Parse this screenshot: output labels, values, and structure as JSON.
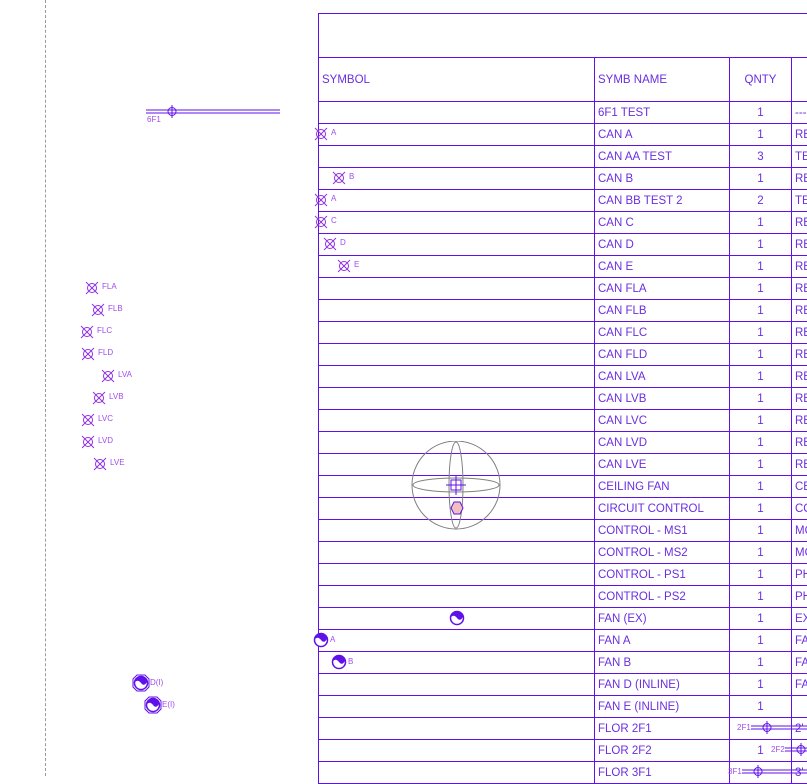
{
  "drawing": {
    "table": {
      "title": "",
      "headers": {
        "symbol": "SYMBOL",
        "symb_name": "SYMB NAME",
        "qnty": "QNTY",
        "desc": ""
      },
      "rows": [
        {
          "name": "6F1 TEST",
          "qty": "1",
          "desc": "---"
        },
        {
          "name": "CAN A",
          "qty": "1",
          "desc": "RE"
        },
        {
          "name": "CAN AA TEST",
          "qty": "3",
          "desc": "TE"
        },
        {
          "name": "CAN B",
          "qty": "1",
          "desc": "RE"
        },
        {
          "name": "CAN BB TEST 2",
          "qty": "2",
          "desc": "TE"
        },
        {
          "name": "CAN C",
          "qty": "1",
          "desc": "RE"
        },
        {
          "name": "CAN D",
          "qty": "1",
          "desc": "RE"
        },
        {
          "name": "CAN E",
          "qty": "1",
          "desc": "RE"
        },
        {
          "name": "CAN FLA",
          "qty": "1",
          "desc": "RE"
        },
        {
          "name": "CAN FLB",
          "qty": "1",
          "desc": "RE"
        },
        {
          "name": "CAN FLC",
          "qty": "1",
          "desc": "RE"
        },
        {
          "name": "CAN FLD",
          "qty": "1",
          "desc": "RE"
        },
        {
          "name": "CAN LVA",
          "qty": "1",
          "desc": "RE"
        },
        {
          "name": "CAN LVB",
          "qty": "1",
          "desc": "RE"
        },
        {
          "name": "CAN LVC",
          "qty": "1",
          "desc": "RE"
        },
        {
          "name": "CAN LVD",
          "qty": "1",
          "desc": "RE"
        },
        {
          "name": "CAN LVE",
          "qty": "1",
          "desc": "RE"
        },
        {
          "name": "CEILING FAN",
          "qty": "1",
          "desc": "CE"
        },
        {
          "name": "CIRCUIT CONTROL",
          "qty": "1",
          "desc": "CO"
        },
        {
          "name": "CONTROL - MS1",
          "qty": "1",
          "desc": "MO"
        },
        {
          "name": "CONTROL - MS2",
          "qty": "1",
          "desc": "MO"
        },
        {
          "name": "CONTROL - PS1",
          "qty": "1",
          "desc": "PH"
        },
        {
          "name": "CONTROL - PS2",
          "qty": "1",
          "desc": "PH"
        },
        {
          "name": "FAN (EX)",
          "qty": "1",
          "desc": "EX"
        },
        {
          "name": "FAN A",
          "qty": "1",
          "desc": "FA"
        },
        {
          "name": "FAN B",
          "qty": "1",
          "desc": "FA"
        },
        {
          "name": "FAN D (INLINE)",
          "qty": "1",
          "desc": "FA"
        },
        {
          "name": "FAN E (INLINE)",
          "qty": "1",
          "desc": ""
        },
        {
          "name": "FLOR 2F1",
          "qty": "",
          "desc": "2'"
        },
        {
          "name": "FLOR 2F2",
          "qty": "1",
          "desc": ""
        },
        {
          "name": "FLOR 3F1",
          "qty": "",
          "desc": "3'"
        }
      ]
    },
    "symbols": {
      "pipe_label_6f1": "6F1",
      "can_labels_table": [
        "A",
        "B",
        "A",
        "C",
        "D",
        "E"
      ],
      "can_labels_left": [
        "FLA",
        "FLB",
        "FLC",
        "FLD",
        "LVA",
        "LVB",
        "LVC",
        "LVD",
        "LVE"
      ],
      "fan_labels_table": [
        "A",
        "B"
      ],
      "fan_labels_left": [
        "D(I)",
        "E(I)"
      ],
      "floor_labels": [
        "2F1",
        "2F2",
        "3F1"
      ]
    },
    "colors": {
      "line": "#6010e8",
      "text": "#6a2fe0",
      "symbol": "#a050e0",
      "fan_gray": "#808080",
      "hex_fill": "#f0c0c0"
    }
  }
}
